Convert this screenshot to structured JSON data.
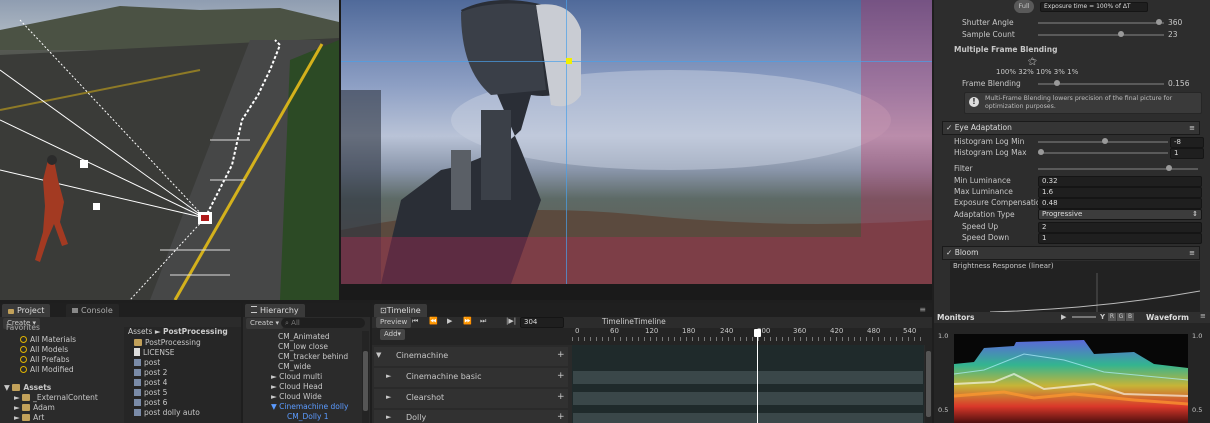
{
  "project": {
    "tabs": [
      "Project",
      "Console"
    ],
    "create": "Create",
    "favorites": [
      "Favorites",
      "All Materials",
      "All Models",
      "All Prefabs",
      "All Modified"
    ],
    "assets_root": "Assets",
    "assets_children": [
      "_ExternalContent",
      "Adam",
      "Art"
    ],
    "breadcrumb_root": "Assets",
    "breadcrumb_sep": "►",
    "breadcrumb_current": "PostProcessing",
    "files": [
      {
        "name": "PostProcessing",
        "icon": "folder"
      },
      {
        "name": "LICENSE",
        "icon": "file"
      },
      {
        "name": "post",
        "icon": "post"
      },
      {
        "name": "post 2",
        "icon": "post"
      },
      {
        "name": "post 4",
        "icon": "post"
      },
      {
        "name": "post 5",
        "icon": "post"
      },
      {
        "name": "post 6",
        "icon": "post"
      },
      {
        "name": "post dolly auto",
        "icon": "post"
      }
    ]
  },
  "hierarchy": {
    "tab": "Hierarchy",
    "create": "Create",
    "search_placeholder": "All",
    "items": [
      {
        "name": "CM_Animated",
        "arrow": ""
      },
      {
        "name": "CM_low close",
        "arrow": ""
      },
      {
        "name": "CM_tracker behind",
        "arrow": ""
      },
      {
        "name": "CM_wide",
        "arrow": ""
      },
      {
        "name": "Cloud multi",
        "arrow": "►"
      },
      {
        "name": "Cloud Head",
        "arrow": "►"
      },
      {
        "name": "Cloud Wide",
        "arrow": "►"
      },
      {
        "name": "Cinemachine dolly",
        "arrow": "▼",
        "selected": true
      },
      {
        "name": "CM_Dolly 1",
        "arrow": "",
        "selected": true
      }
    ]
  },
  "timeline": {
    "tab": "Timeline",
    "preview": "Preview",
    "frame": "304",
    "asset_name": "TimelineTimeline",
    "add": "Add▾",
    "ruler": [
      "0",
      "60",
      "120",
      "180",
      "240",
      "300",
      "360",
      "420",
      "480",
      "540"
    ],
    "tracks": [
      {
        "name": "Cinemachine",
        "indent": 0
      },
      {
        "name": "Cinemachine basic",
        "indent": 1
      },
      {
        "name": "Clearshot",
        "indent": 1
      },
      {
        "name": "Dolly",
        "indent": 1
      }
    ]
  },
  "inspector": {
    "top_button": "Full",
    "exposure_info": "Exposure time = 100% of ΔT",
    "shutter_angle_label": "Shutter Angle",
    "shutter_angle_value": "360",
    "sample_count_label": "Sample Count",
    "sample_count_value": "23",
    "mfb_title": "Multiple Frame Blending",
    "mfb_weights": "100% 32% 10% 3% 1%",
    "frame_blending_label": "Frame Blending",
    "frame_blending_value": "0.156",
    "mfb_note": "Multi-Frame Blending lowers precision of the final picture for optimization purposes.",
    "eye_adaptation": {
      "title": "Eye Adaptation",
      "rows": [
        {
          "label": "Histogram Log Min",
          "value": "-8",
          "slider": 0.55
        },
        {
          "label": "Histogram Log Max",
          "value": "1",
          "slider": 0.02
        },
        {
          "label": "Filter",
          "value": "",
          "slider": 0.98
        },
        {
          "label": "Min Luminance",
          "value": "0.32"
        },
        {
          "label": "Max Luminance",
          "value": "1.6"
        },
        {
          "label": "Exposure Compensatio",
          "value": "0.48"
        },
        {
          "label": "Adaptation Type",
          "value": "Progressive"
        },
        {
          "label": "Speed Up",
          "value": "2"
        },
        {
          "label": "Speed Down",
          "value": "1"
        }
      ]
    },
    "bloom": {
      "title": "Bloom",
      "response_label": "Brightness Response (linear)"
    }
  },
  "monitors": {
    "title": "Monitors",
    "channels": [
      "Y",
      "R",
      "G",
      "B"
    ],
    "mode": "Waveform",
    "axis": [
      "1.0",
      "0.5",
      "1.0",
      "0.5"
    ]
  },
  "colors": {
    "selection": "#3e5f96",
    "accent": "#4a8cd6",
    "panel": "#2b2b2b"
  }
}
